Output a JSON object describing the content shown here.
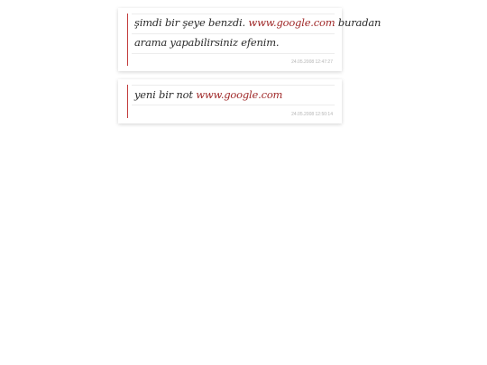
{
  "notes": [
    {
      "line1_pre": "şimdi bir şeye benzdi. ",
      "line1_link": "www.google.com",
      "line1_post": " buradan",
      "line2": "arama yapabilirsiniz efenim.",
      "date": "24.05.2008 12:47:27"
    },
    {
      "line1_pre": "yeni bir not ",
      "line1_link": "www.google.com",
      "date": "24.05.2008 12:50:14"
    }
  ]
}
